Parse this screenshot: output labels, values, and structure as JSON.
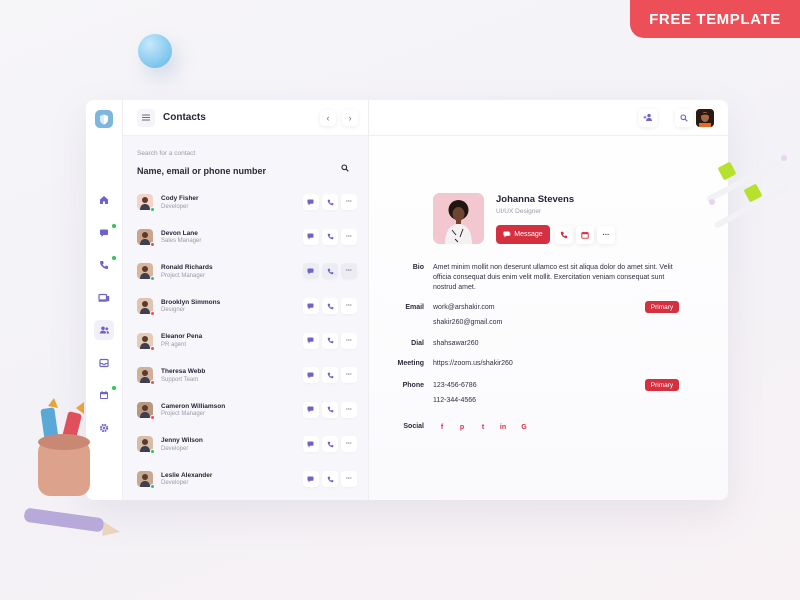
{
  "ribbon": "FREE TEMPLATE",
  "colors": {
    "accent": "#d5303f",
    "online": "#2ec45a",
    "offline": "#f04b57",
    "nav_icon": "#6e63c9"
  },
  "nav": {
    "logo_icon": "shield-icon",
    "items": [
      {
        "icon": "home-icon",
        "dot": false
      },
      {
        "icon": "chat-icon",
        "dot": true
      },
      {
        "icon": "phone-icon",
        "dot": true
      },
      {
        "icon": "devices-icon",
        "dot": false
      },
      {
        "icon": "contacts-icon",
        "dot": false,
        "active": true
      },
      {
        "icon": "inbox-icon",
        "dot": false
      },
      {
        "icon": "calendar-icon",
        "dot": true
      },
      {
        "icon": "settings-icon",
        "dot": false
      }
    ]
  },
  "list": {
    "title": "Contacts",
    "prev": "‹",
    "next": "›",
    "search_label": "Search for a contact",
    "search_placeholder": "Name, email or phone number",
    "contacts": [
      {
        "name": "Cody Fisher",
        "role": "Developer",
        "status": "online"
      },
      {
        "name": "Devon Lane",
        "role": "Sales Manager",
        "status": "offline"
      },
      {
        "name": "Ronald Richards",
        "role": "Project Manager",
        "status": "online"
      },
      {
        "name": "Brooklyn Simmons",
        "role": "Designer",
        "status": "offline"
      },
      {
        "name": "Eleanor Pena",
        "role": "PR agent",
        "status": "offline"
      },
      {
        "name": "Theresa Webb",
        "role": "Support Team",
        "status": "offline"
      },
      {
        "name": "Cameron Williamson",
        "role": "Project Manager",
        "status": "offline"
      },
      {
        "name": "Jenny Wilson",
        "role": "Developer",
        "status": "online"
      },
      {
        "name": "Leslie Alexander",
        "role": "Developer",
        "status": "online"
      }
    ]
  },
  "profile": {
    "name": "Johanna Stevens",
    "role": "UI/UX Designer",
    "message_label": "Message",
    "more": "···",
    "fields": {
      "bio_label": "Bio",
      "bio": "Amet minim mollit non deserunt ullamco est sit aliqua dolor do amet sint. Velit officia consequat duis enim velit mollit. Exercitation veniam consequat sunt nostrud amet.",
      "email_label": "Email",
      "email_primary": "work@arshakir.com",
      "email_secondary": "shakir260@gmail.com",
      "dial_label": "Dial",
      "dial": "shahsawar260",
      "meeting_label": "Meeting",
      "meeting": "https://zoom.us/shakir260",
      "phone_label": "Phone",
      "phone_primary": "123-456-6786",
      "phone_secondary": "112-344-4566",
      "social_label": "Social",
      "primary_badge": "Primary"
    },
    "social": [
      "f",
      "p",
      "t",
      "in",
      "G"
    ]
  }
}
